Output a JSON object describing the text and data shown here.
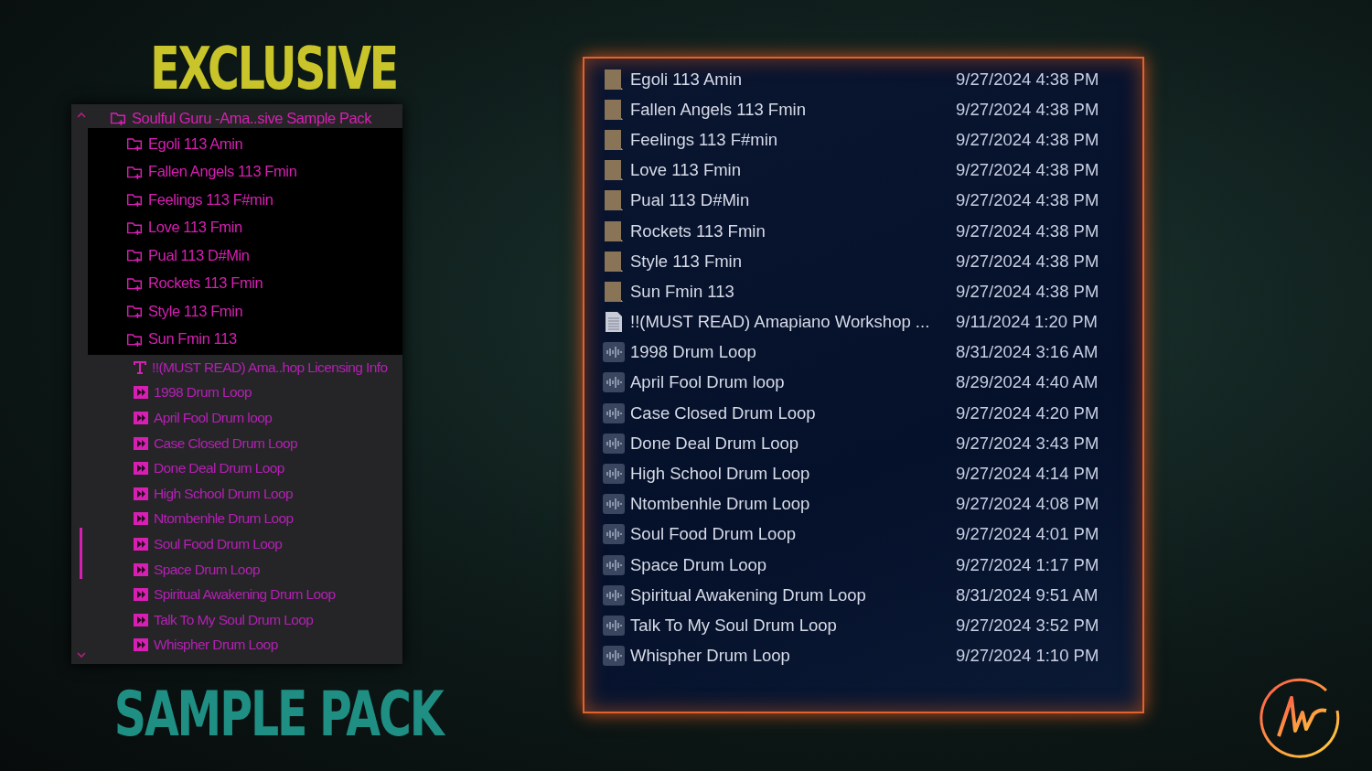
{
  "headline": {
    "top": "EXCLUSIVE",
    "bottom": "SAMPLE PACK"
  },
  "tree": {
    "root": {
      "label": "Soulful Guru -Ama..sive Sample Pack",
      "expanded": true,
      "children": [
        {
          "label": "Egoli 113 Amin"
        },
        {
          "label": "Fallen Angels 113 Fmin"
        },
        {
          "label": "Feelings 113 F#min"
        },
        {
          "label": "Love 113 Fmin"
        },
        {
          "label": "Pual 113 D#Min"
        },
        {
          "label": "Rockets 113 Fmin"
        },
        {
          "label": "Style 113 Fmin"
        },
        {
          "label": "Sun Fmin 113"
        }
      ]
    },
    "files": [
      {
        "kind": "text",
        "label": "!!(MUST  READ) Ama..hop Licensing Info"
      },
      {
        "kind": "audio",
        "label": "1998 Drum Loop"
      },
      {
        "kind": "audio",
        "label": "April Fool Drum loop"
      },
      {
        "kind": "audio",
        "label": "Case Closed Drum Loop"
      },
      {
        "kind": "audio",
        "label": "Done Deal Drum Loop"
      },
      {
        "kind": "audio",
        "label": "High School Drum Loop"
      },
      {
        "kind": "audio",
        "label": "Ntombenhle Drum Loop"
      },
      {
        "kind": "audio",
        "label": "Soul Food Drum Loop"
      },
      {
        "kind": "audio",
        "label": "Space Drum Loop"
      },
      {
        "kind": "audio",
        "label": "Spiritual Awakening Drum Loop"
      },
      {
        "kind": "audio",
        "label": "Talk To My Soul Drum Loop"
      },
      {
        "kind": "audio",
        "label": "Whispher Drum Loop"
      }
    ]
  },
  "file_list": [
    {
      "kind": "folder",
      "name": "Egoli 113 Amin",
      "date": "9/27/2024 4:38 PM"
    },
    {
      "kind": "folder",
      "name": "Fallen Angels 113 Fmin",
      "date": "9/27/2024 4:38 PM"
    },
    {
      "kind": "folder",
      "name": "Feelings 113 F#min",
      "date": "9/27/2024 4:38 PM"
    },
    {
      "kind": "folder",
      "name": "Love 113 Fmin",
      "date": "9/27/2024 4:38 PM"
    },
    {
      "kind": "folder",
      "name": "Pual 113 D#Min",
      "date": "9/27/2024 4:38 PM"
    },
    {
      "kind": "folder",
      "name": "Rockets 113 Fmin",
      "date": "9/27/2024 4:38 PM"
    },
    {
      "kind": "folder",
      "name": "Style 113 Fmin",
      "date": "9/27/2024 4:38 PM"
    },
    {
      "kind": "folder",
      "name": "Sun Fmin 113",
      "date": "9/27/2024 4:38 PM"
    },
    {
      "kind": "document",
      "name": "!!(MUST  READ) Amapiano Workshop ...",
      "date": "9/11/2024 1:20 PM"
    },
    {
      "kind": "audio",
      "name": "1998 Drum Loop",
      "date": "8/31/2024 3:16 AM"
    },
    {
      "kind": "audio",
      "name": "April Fool Drum loop",
      "date": "8/29/2024 4:40 AM"
    },
    {
      "kind": "audio",
      "name": "Case Closed Drum Loop",
      "date": "9/27/2024 4:20 PM"
    },
    {
      "kind": "audio",
      "name": "Done Deal Drum Loop",
      "date": "9/27/2024 3:43 PM"
    },
    {
      "kind": "audio",
      "name": "High School Drum Loop",
      "date": "9/27/2024 4:14 PM"
    },
    {
      "kind": "audio",
      "name": "Ntombenhle Drum Loop",
      "date": "9/27/2024 4:08 PM"
    },
    {
      "kind": "audio",
      "name": "Soul Food Drum Loop",
      "date": "9/27/2024 4:01 PM"
    },
    {
      "kind": "audio",
      "name": "Space Drum Loop",
      "date": "9/27/2024 1:17 PM"
    },
    {
      "kind": "audio",
      "name": "Spiritual Awakening Drum Loop",
      "date": "8/31/2024 9:51 AM"
    },
    {
      "kind": "audio",
      "name": "Talk To My Soul Drum Loop",
      "date": "9/27/2024 3:52 PM"
    },
    {
      "kind": "audio",
      "name": "Whispher Drum Loop",
      "date": "9/27/2024 1:10 PM"
    }
  ]
}
